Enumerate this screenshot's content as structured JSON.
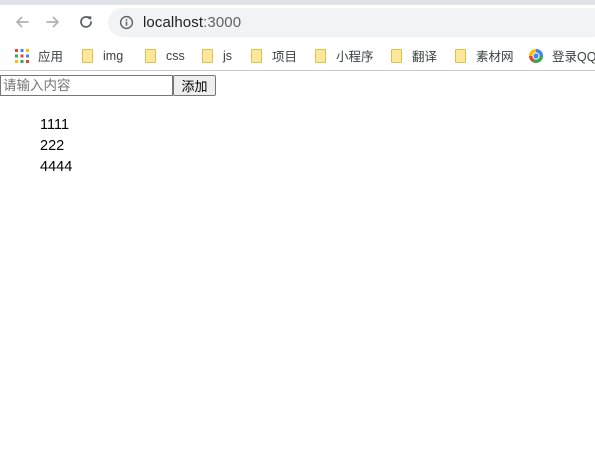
{
  "browser": {
    "url_host": "localhost",
    "url_port": ":3000",
    "bookmarks": [
      {
        "label": "应用",
        "icon": "apps-grid-icon"
      },
      {
        "label": "img",
        "icon": "folder-icon"
      },
      {
        "label": "css",
        "icon": "folder-icon"
      },
      {
        "label": "js",
        "icon": "folder-icon"
      },
      {
        "label": "项目",
        "icon": "folder-icon"
      },
      {
        "label": "小程序",
        "icon": "folder-icon"
      },
      {
        "label": "翻译",
        "icon": "folder-icon"
      },
      {
        "label": "素材网",
        "icon": "folder-icon"
      },
      {
        "label": "登录QQ",
        "icon": "qq-icon"
      }
    ]
  },
  "form": {
    "placeholder": "请输入内容",
    "value": "",
    "add_label": "添加"
  },
  "items": [
    "1111",
    "222",
    "4444"
  ]
}
